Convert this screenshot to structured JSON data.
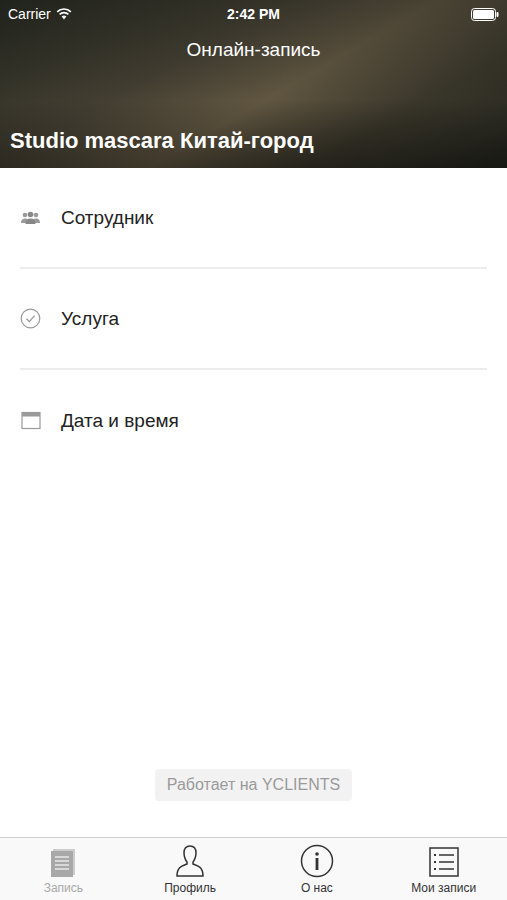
{
  "status_bar": {
    "carrier": "Carrier",
    "time": "2:42 PM"
  },
  "header": {
    "title": "Онлайн-запись",
    "studio": "Studio mascara Китай-город"
  },
  "steps": [
    {
      "label": "Сотрудник",
      "kind": "staff"
    },
    {
      "label": "Услуга",
      "kind": "service"
    },
    {
      "label": "Дата и время",
      "kind": "date"
    }
  ],
  "powered_by": "Работает на YCLIENTS",
  "tabs": [
    {
      "label": "Запись",
      "kind": "booking",
      "selected": true
    },
    {
      "label": "Профиль",
      "kind": "profile",
      "selected": false
    },
    {
      "label": "О нас",
      "kind": "about",
      "selected": false
    },
    {
      "label": "Мои записи",
      "kind": "records",
      "selected": false
    }
  ]
}
